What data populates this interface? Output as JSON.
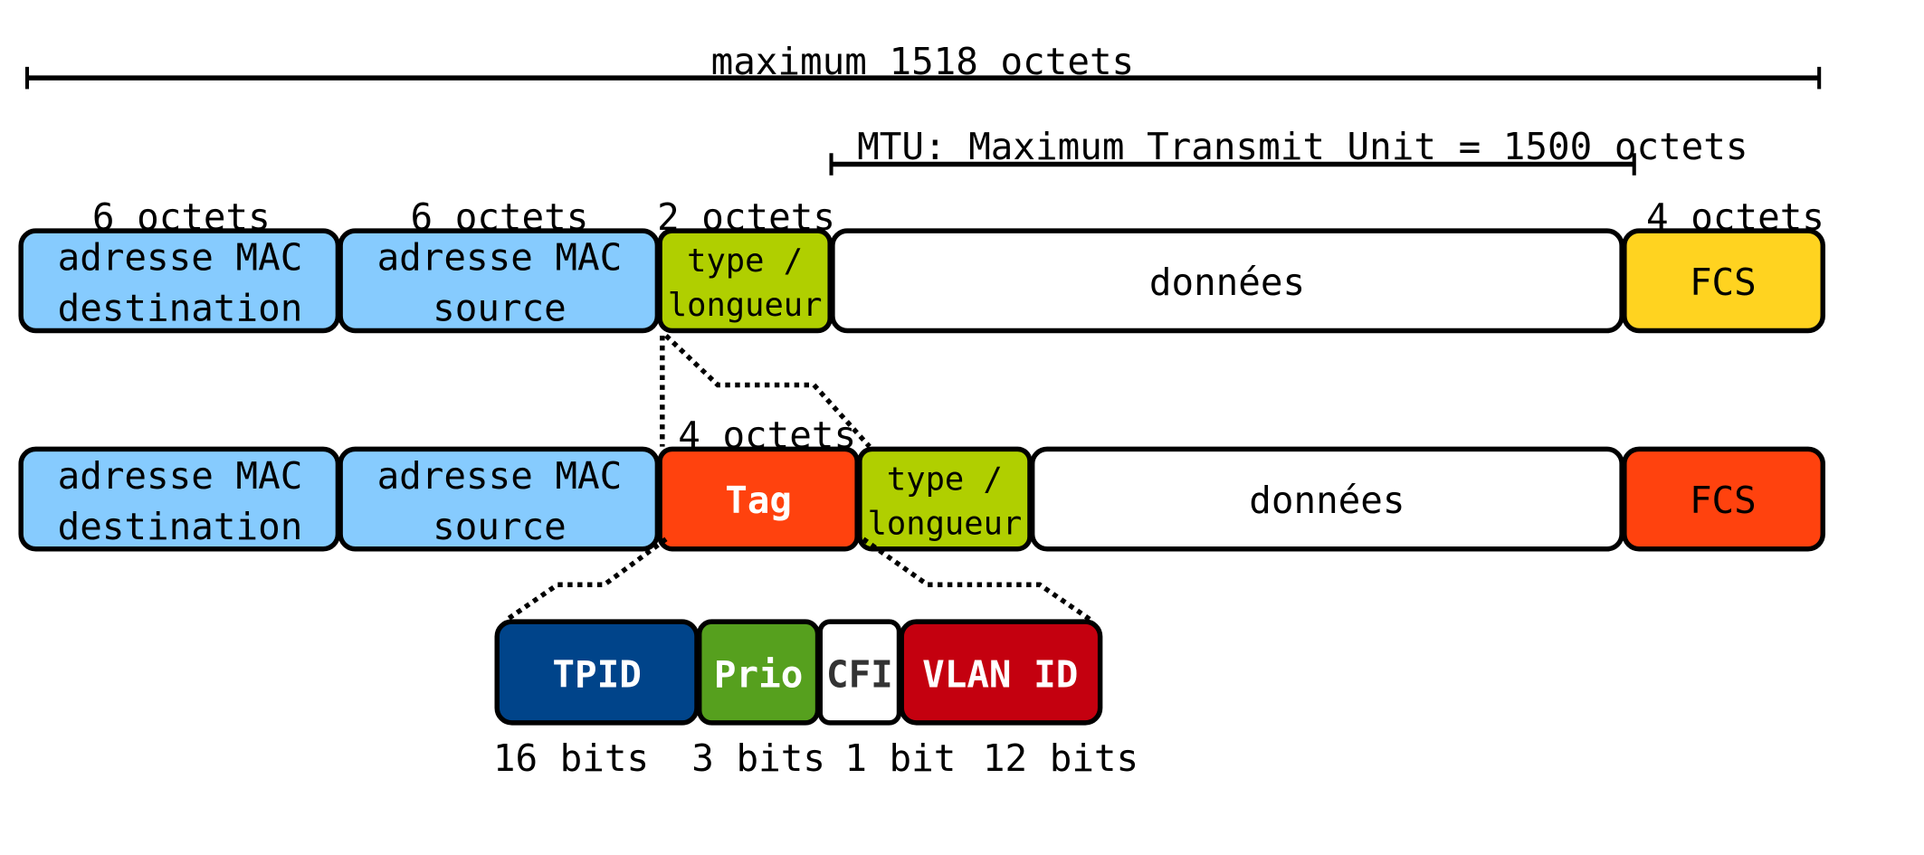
{
  "dimensions": {
    "total": "maximum 1518 octets",
    "mtu": "MTU: Maximum Transmit Unit = 1500 octets"
  },
  "frame": {
    "sizes": [
      "6 octets",
      "6 octets",
      "2 octets",
      "4 octets"
    ],
    "fields": [
      {
        "line1": "adresse MAC",
        "line2": "destination",
        "color": "#86cbfe"
      },
      {
        "line1": "adresse MAC",
        "line2": "source",
        "color": "#86cbfe"
      },
      {
        "line1": "type /",
        "line2": "longueur",
        "color": "#b0cf00"
      },
      {
        "label": "données",
        "color": "#ffffff"
      },
      {
        "label": "FCS",
        "color": "#ffd320"
      }
    ]
  },
  "tagged_frame": {
    "tag_size": "4 octets",
    "fields": [
      {
        "line1": "adresse MAC",
        "line2": "destination",
        "color": "#86cbfe"
      },
      {
        "line1": "adresse MAC",
        "line2": "source",
        "color": "#86cbfe"
      },
      {
        "label": "Tag",
        "color": "#ff420e"
      },
      {
        "line1": "type /",
        "line2": "longueur",
        "color": "#b0cf00"
      },
      {
        "label": "données",
        "color": "#ffffff"
      },
      {
        "label": "FCS",
        "color": "#ff420e"
      }
    ]
  },
  "tag": {
    "fields": [
      {
        "label": "TPID",
        "bits": "16 bits",
        "color": "#00448a"
      },
      {
        "label": "Prio",
        "bits": "3 bits",
        "color": "#56a01e"
      },
      {
        "label": "CFI",
        "bits": "1 bit",
        "color": "#ffffff"
      },
      {
        "label": "VLAN ID",
        "bits": "12 bits",
        "color": "#c4000f"
      }
    ]
  }
}
